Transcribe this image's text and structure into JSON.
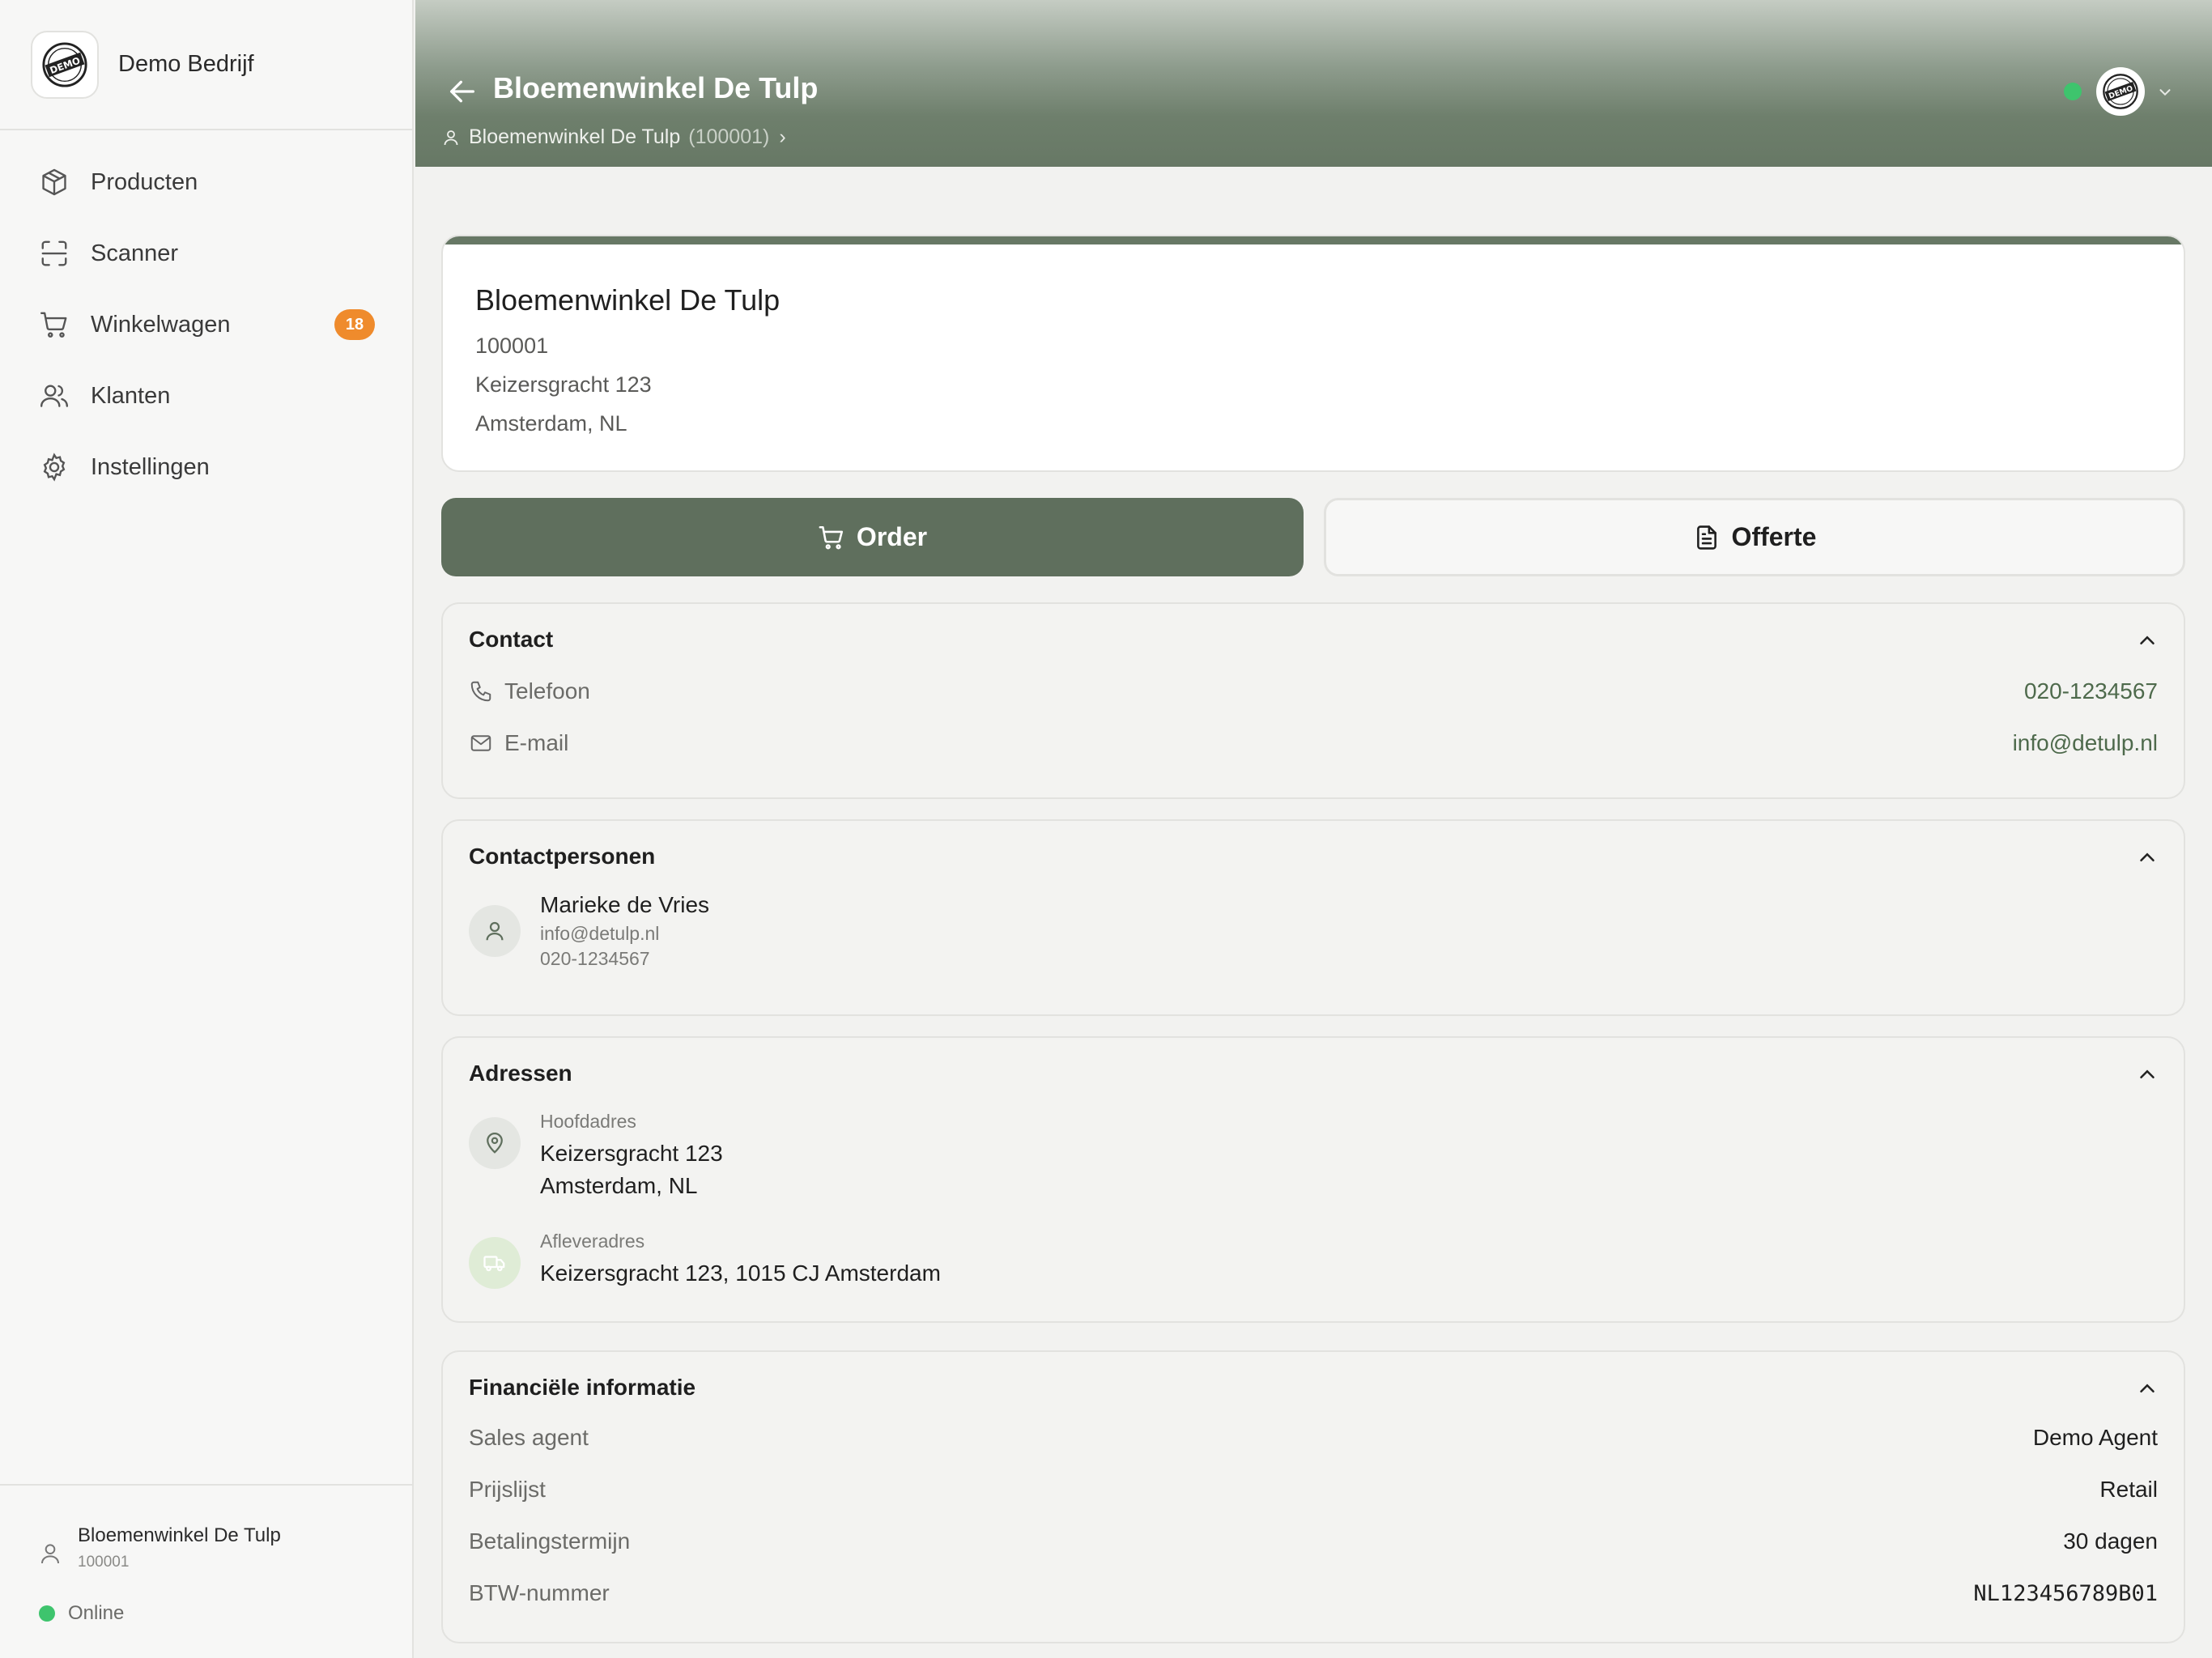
{
  "sidebar": {
    "brand_name": "Demo Bedrijf",
    "items": [
      {
        "label": "Producten",
        "icon": "package-icon"
      },
      {
        "label": "Scanner",
        "icon": "scan-icon"
      },
      {
        "label": "Winkelwagen",
        "icon": "cart-icon",
        "badge": "18"
      },
      {
        "label": "Klanten",
        "icon": "users-icon"
      },
      {
        "label": "Instellingen",
        "icon": "gear-icon"
      }
    ],
    "footer": {
      "customer_name": "Bloemenwinkel De Tulp",
      "customer_id": "100001",
      "status": "Online"
    }
  },
  "header": {
    "title": "Bloemenwinkel De Tulp",
    "breadcrumb_name": "Bloemenwinkel De Tulp",
    "breadcrumb_id": "(100001)",
    "breadcrumb_chevron": "›"
  },
  "customer": {
    "name": "Bloemenwinkel De Tulp",
    "number": "100001",
    "street": "Keizersgracht 123",
    "city": "Amsterdam, NL"
  },
  "actions": {
    "order_label": "Order",
    "offerte_label": "Offerte"
  },
  "contact": {
    "title": "Contact",
    "phone_label": "Telefoon",
    "phone_value": "020-1234567",
    "email_label": "E-mail",
    "email_value": "info@detulp.nl"
  },
  "contactpersons": {
    "title": "Contactpersonen",
    "people": [
      {
        "name": "Marieke de Vries",
        "email": "info@detulp.nl",
        "phone": "020-1234567"
      }
    ]
  },
  "addresses": {
    "title": "Adressen",
    "main_label": "Hoofdadres",
    "main_line1": "Keizersgracht 123",
    "main_line2": "Amsterdam, NL",
    "delivery_label": "Afleveradres",
    "delivery_line": "Keizersgracht 123, 1015 CJ Amsterdam"
  },
  "financial": {
    "title": "Financiële informatie",
    "rows": [
      {
        "label": "Sales agent",
        "value": "Demo Agent"
      },
      {
        "label": "Prijslijst",
        "value": "Retail"
      },
      {
        "label": "Betalingstermijn",
        "value": "30 dagen"
      },
      {
        "label": "BTW-nummer",
        "value": "NL123456789B01"
      }
    ]
  },
  "colors": {
    "accent": "#5f6f5d",
    "badge": "#ef8b2c",
    "online": "#3ec46d"
  }
}
